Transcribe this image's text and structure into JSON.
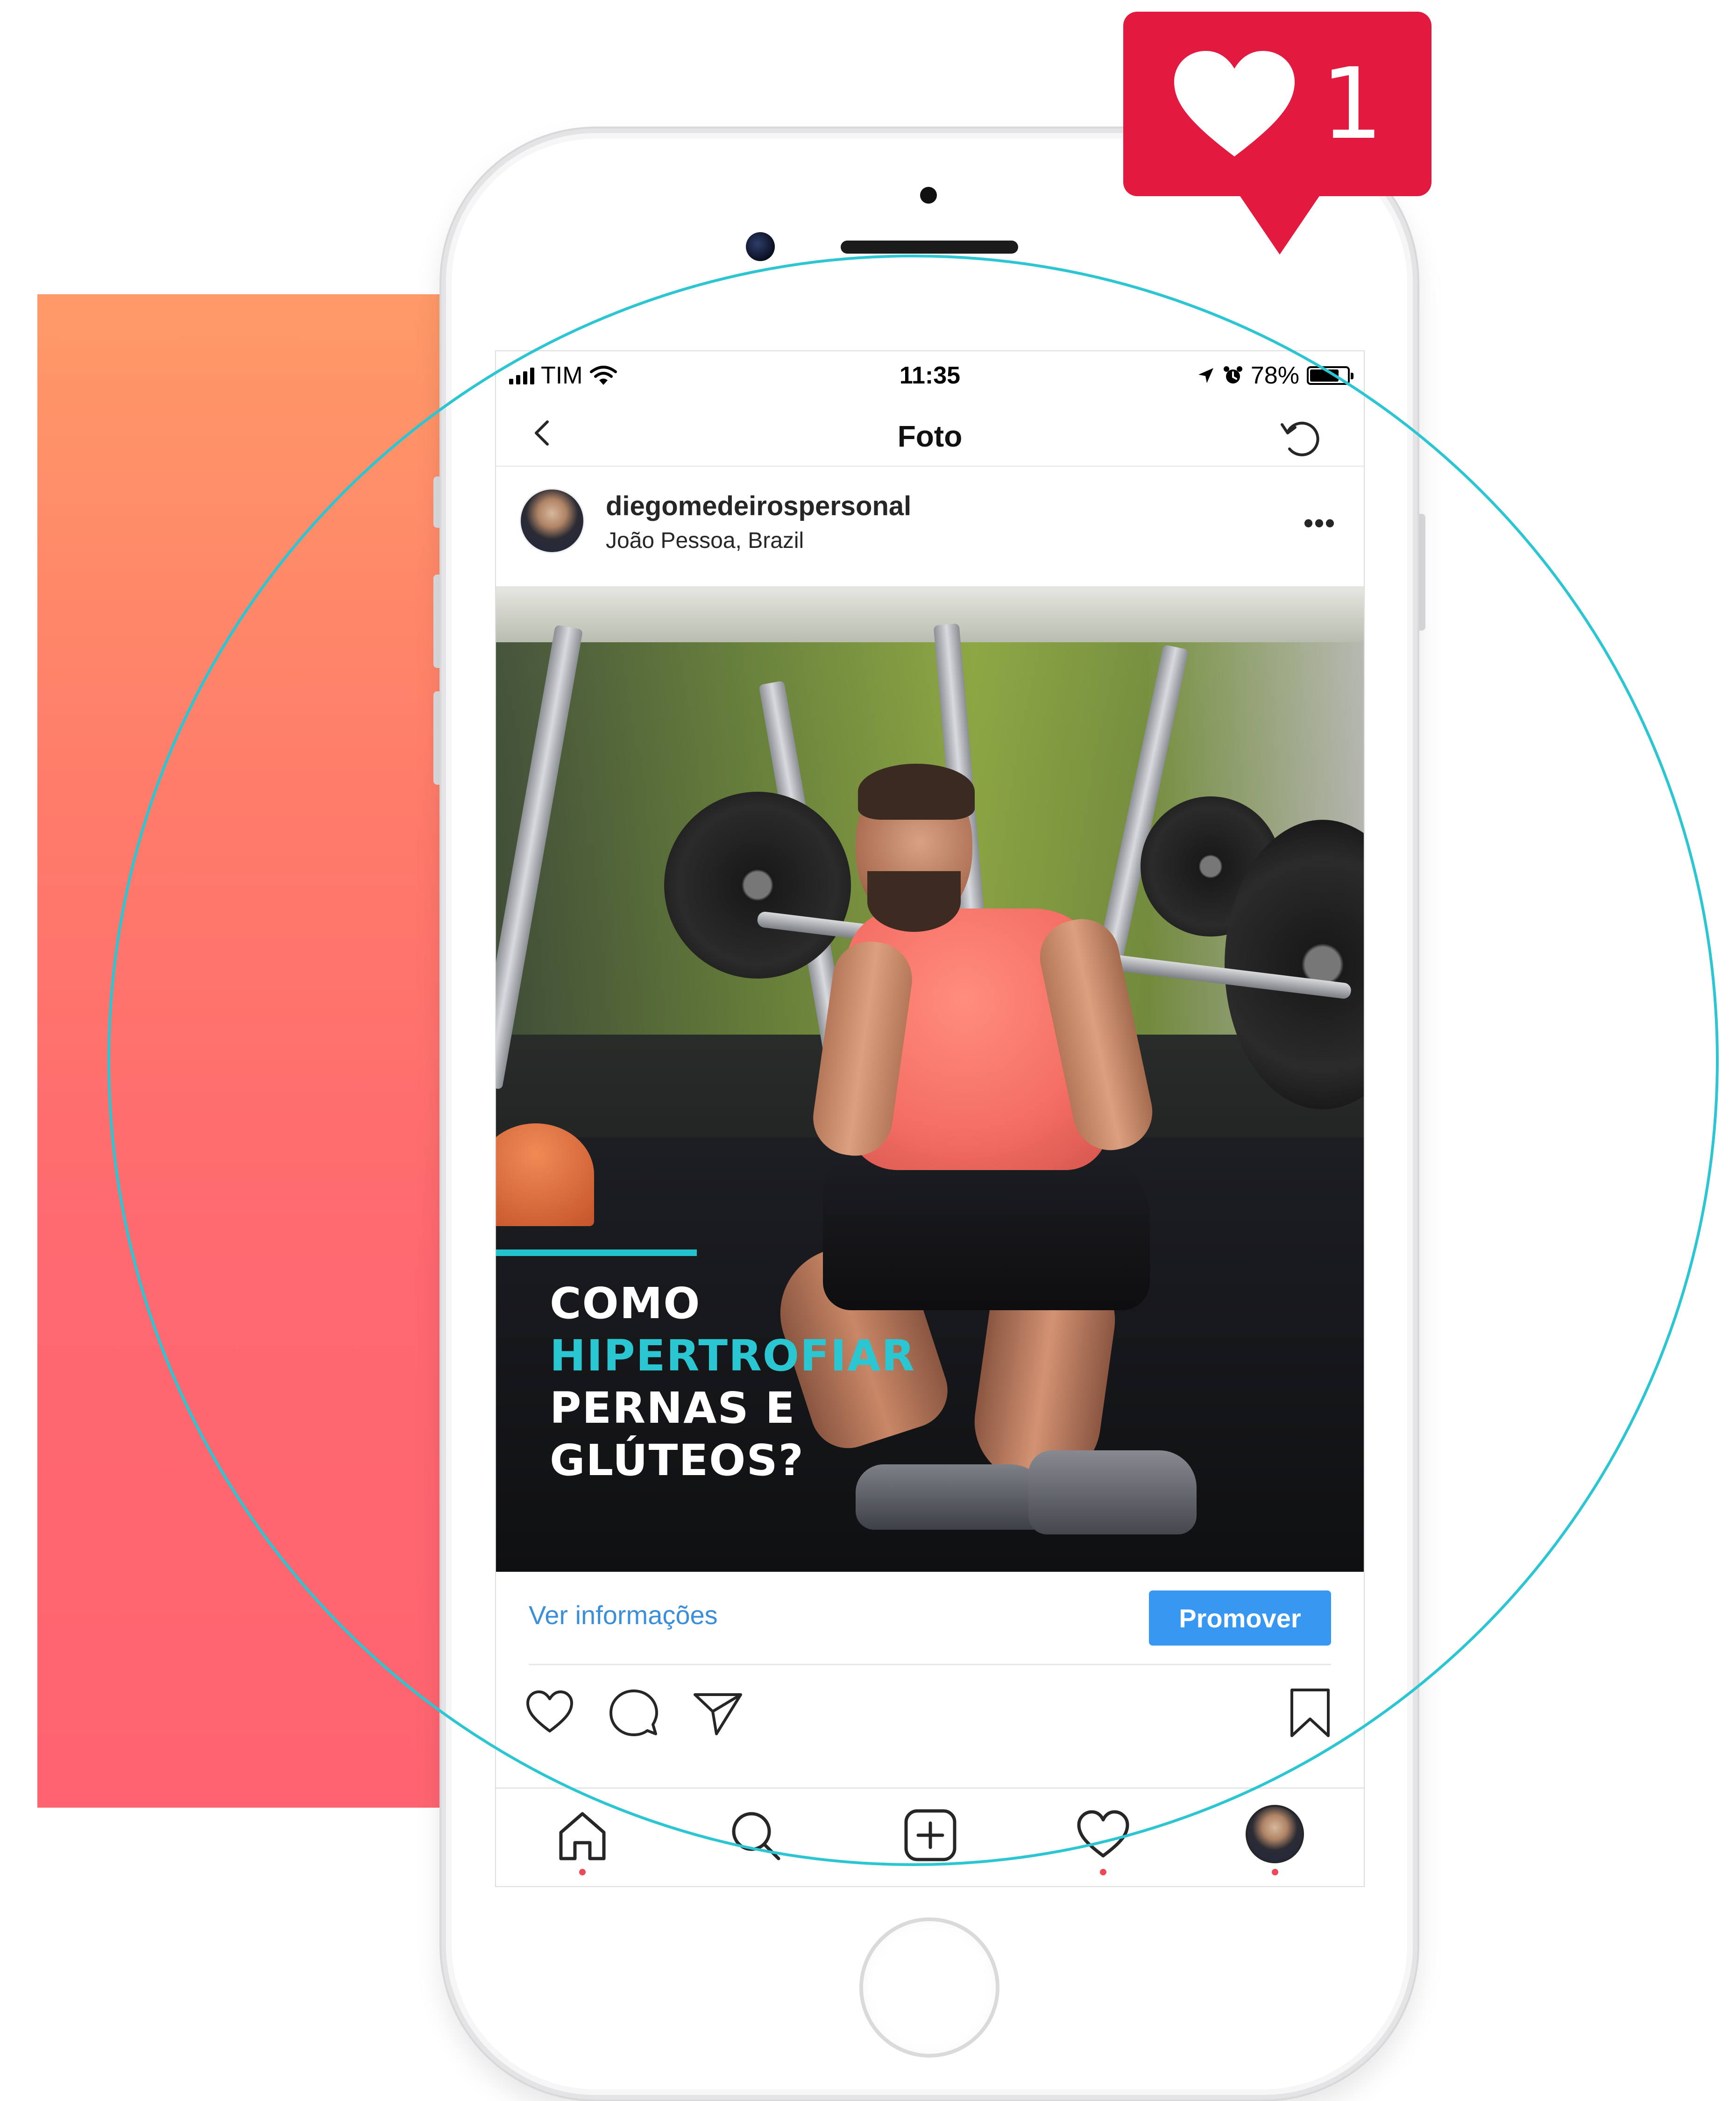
{
  "notification": {
    "like_count": "1",
    "color": "#e31a3f",
    "icon": "heart-icon"
  },
  "status_bar": {
    "carrier": "TIM",
    "time": "11:35",
    "battery": "78%",
    "battery_level": 0.78
  },
  "nav": {
    "title": "Foto",
    "back_icon": "chevron-left-icon",
    "refresh_icon": "refresh-icon"
  },
  "post": {
    "username": "diegomedeirospersonal",
    "location": "João Pessoa, Brazil",
    "more_label": "•••",
    "image_text": {
      "line1": "COMO",
      "line2": "HIPERTROFIAR",
      "line3": "PERNAS E",
      "line4": "GLÚTEOS?"
    },
    "accent_color": "#2ac6d2"
  },
  "info_row": {
    "link_label": "Ver informações",
    "button_label": "Promover"
  },
  "actions": {
    "like": "heart-icon",
    "comment": "comment-icon",
    "share": "send-icon",
    "save": "bookmark-icon"
  },
  "tabbar": {
    "items": [
      "home-icon",
      "search-icon",
      "add-icon",
      "activity-icon",
      "profile-avatar"
    ]
  },
  "colors": {
    "brand_blue": "#3897f0",
    "background_gradient": "#ff7a6a",
    "circle": "#2cc6d3"
  }
}
